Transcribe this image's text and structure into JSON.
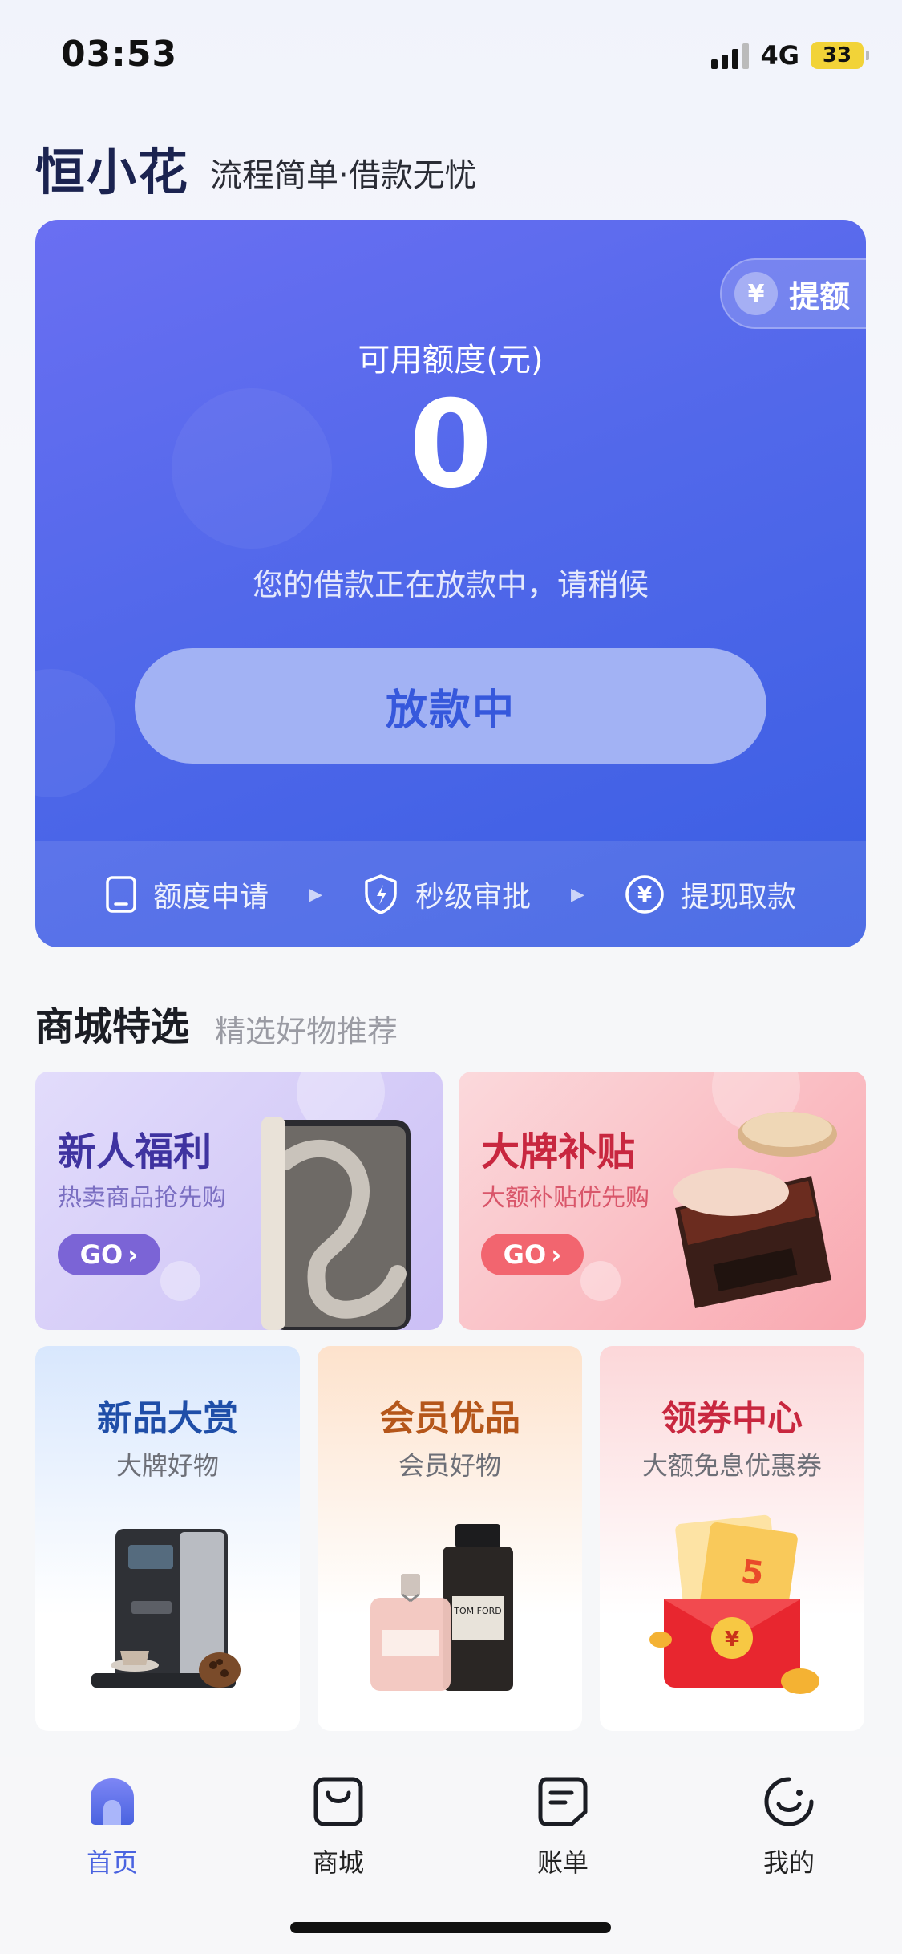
{
  "status_bar": {
    "time": "03:53",
    "network": "4G",
    "battery": "33"
  },
  "brand": {
    "logo": "恒小花",
    "slogan": "流程简单·借款无忧"
  },
  "credit": {
    "raise_label": "提额",
    "available_label": "可用额度(元)",
    "amount": "0",
    "status_message": "您的借款正在放款中，请稍候",
    "button_label": "放款中",
    "steps": [
      {
        "label": "额度申请",
        "icon": "phone-icon"
      },
      {
        "label": "秒级审批",
        "icon": "shield-bolt-icon"
      },
      {
        "label": "提现取款",
        "icon": "yen-circle-icon"
      }
    ]
  },
  "mall": {
    "title": "商城特选",
    "subtitle": "精选好物推荐",
    "promos": [
      {
        "title": "新人福利",
        "subtitle": "热卖商品抢先购",
        "go": "GO"
      },
      {
        "title": "大牌补贴",
        "subtitle": "大额补贴优先购",
        "go": "GO"
      }
    ],
    "categories": [
      {
        "title": "新品大赏",
        "subtitle": "大牌好物"
      },
      {
        "title": "会员优品",
        "subtitle": "会员好物"
      },
      {
        "title": "领券中心",
        "subtitle": "大额免息优惠券"
      }
    ]
  },
  "tabbar": {
    "items": [
      {
        "label": "首页",
        "icon": "home-icon",
        "active": true
      },
      {
        "label": "商城",
        "icon": "shopping-bag-icon",
        "active": false
      },
      {
        "label": "账单",
        "icon": "bill-icon",
        "active": false
      },
      {
        "label": "我的",
        "icon": "smiley-icon",
        "active": false
      }
    ]
  },
  "colors": {
    "accent": "#4a63e0",
    "card_gradient_start": "#6a6ff2",
    "card_gradient_end": "#3a5ee3"
  }
}
